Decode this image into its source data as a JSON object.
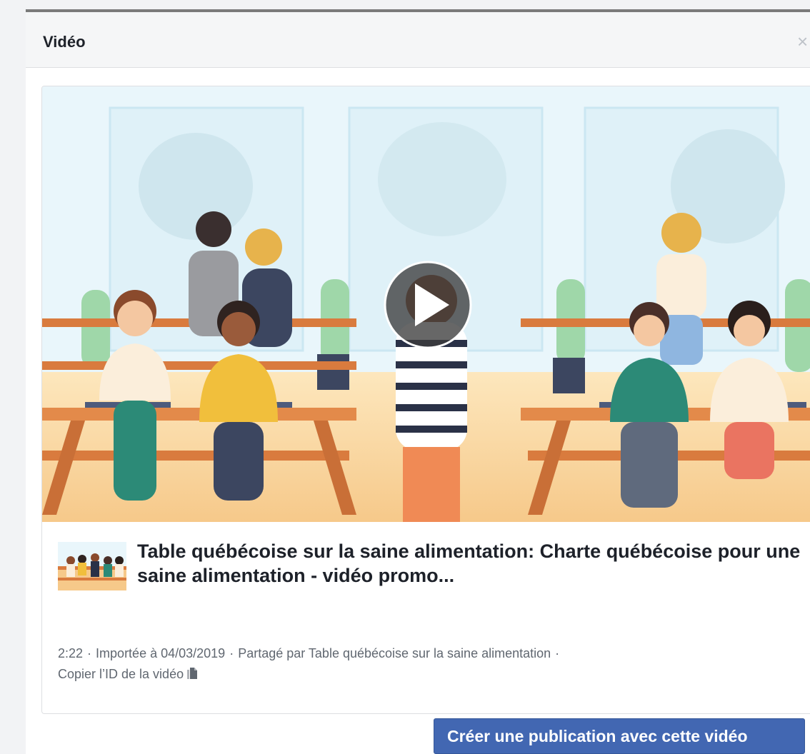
{
  "dialog": {
    "title": "Vidéo",
    "close_glyph": "×"
  },
  "video": {
    "title": "Table québécoise sur la saine alimentation: Charte québécoise pour une saine alimentation - vidéo promo...",
    "duration": "2:22",
    "uploaded": "Importée à 04/03/2019",
    "shared_by": "Partagé par Table québécoise sur la saine alimentation",
    "separator": "·",
    "copy_id_label": "Copier l’ID de la vidéo",
    "play_icon": "play-icon",
    "copy_icon": "copy-icon"
  },
  "footer": {
    "create_post_label": "Créer une publication avec cette vidéo"
  },
  "colors": {
    "primary_button": "#4267b2",
    "header_bg": "#f5f6f7",
    "meta_text": "#606770"
  }
}
